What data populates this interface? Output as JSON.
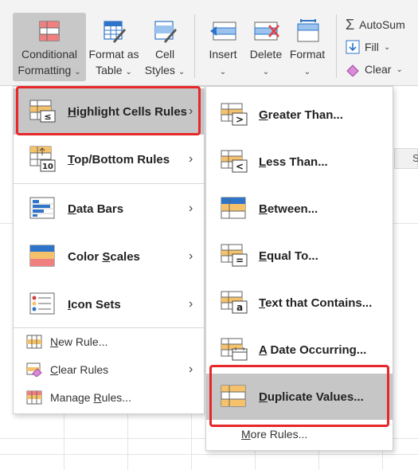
{
  "ribbon": {
    "conditional_formatting": {
      "line1": "Conditional",
      "line2": "Formatting"
    },
    "format_as_table": {
      "line1": "Format as",
      "line2": "Table"
    },
    "cell_styles": {
      "line1": "Cell",
      "line2": "Styles"
    },
    "insert": "Insert",
    "delete": "Delete",
    "format": "Format",
    "autosum": "AutoSum",
    "fill": "Fill",
    "clear": "Clear"
  },
  "sheet": {
    "column_header": "S"
  },
  "menu": {
    "items": [
      {
        "label_u": "H",
        "label_rest": "ighlight Cells Rules",
        "icon": "highlight-cells-icon"
      },
      {
        "label_u": "T",
        "label_rest": "op/Bottom Rules",
        "icon": "top-bottom-icon"
      },
      {
        "label_u": "D",
        "label_rest": "ata Bars",
        "icon": "data-bars-icon"
      },
      {
        "label_pre": "Color ",
        "label_u": "S",
        "label_rest": "cales",
        "icon": "color-scales-icon"
      },
      {
        "label_u": "I",
        "label_rest": "con Sets",
        "icon": "icon-sets-icon"
      }
    ],
    "new_rule": {
      "label_u": "N",
      "label_rest": "ew Rule..."
    },
    "clear_rules": {
      "label_u": "C",
      "label_rest": "lear Rules"
    },
    "manage_rules": {
      "label_pre": "Manage ",
      "label_u": "R",
      "label_rest": "ules..."
    }
  },
  "submenu": {
    "items": [
      {
        "label_u": "G",
        "label_rest": "reater Than..."
      },
      {
        "label_u": "L",
        "label_rest": "ess Than..."
      },
      {
        "label_u": "B",
        "label_rest": "etween..."
      },
      {
        "label_u": "E",
        "label_rest": "qual To..."
      },
      {
        "label_u": "T",
        "label_rest": "ext that Contains..."
      },
      {
        "label_u": "A",
        "label_rest": " Date Occurring..."
      },
      {
        "label_u": "D",
        "label_rest": "uplicate Values..."
      }
    ],
    "more_rules": {
      "label_u": "M",
      "label_rest": "ore Rules..."
    }
  },
  "colors": {
    "highlight": "#c6c6c6",
    "red_box": "#e8272a",
    "accent_blue": "#2e74c8",
    "accent_orange": "#f5c26b"
  }
}
